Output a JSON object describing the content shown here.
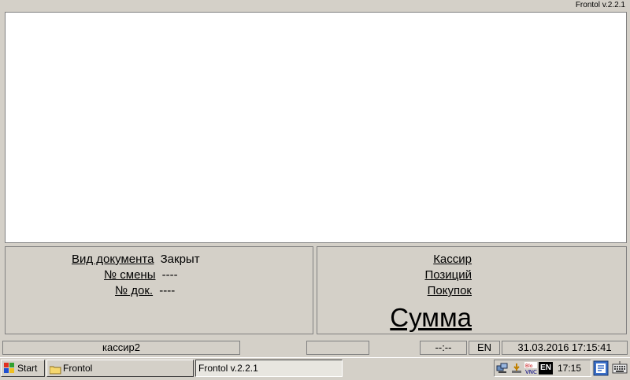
{
  "app": {
    "title": "Frontol v.2.2.1"
  },
  "document_info": {
    "doc_type_label": "Вид документа",
    "doc_type_value": "Закрыт",
    "shift_label": "№ смены",
    "shift_value": "----",
    "doc_no_label": "№ док.",
    "doc_no_value": "----"
  },
  "totals": {
    "cashier_label": "Кассир",
    "positions_label": "Позиций",
    "purchases_label": "Покупок",
    "sum_label": "Сумма"
  },
  "status_bar": {
    "cashier": "кассир2",
    "time_placeholder": "--:--",
    "language": "EN",
    "datetime": "31.03.2016 17:15:41"
  },
  "taskbar": {
    "start_label": "Start",
    "folder_label": "Frontol",
    "window_label": "Frontol v.2.2.1",
    "tray_lang": "EN",
    "clock": "17:15"
  }
}
